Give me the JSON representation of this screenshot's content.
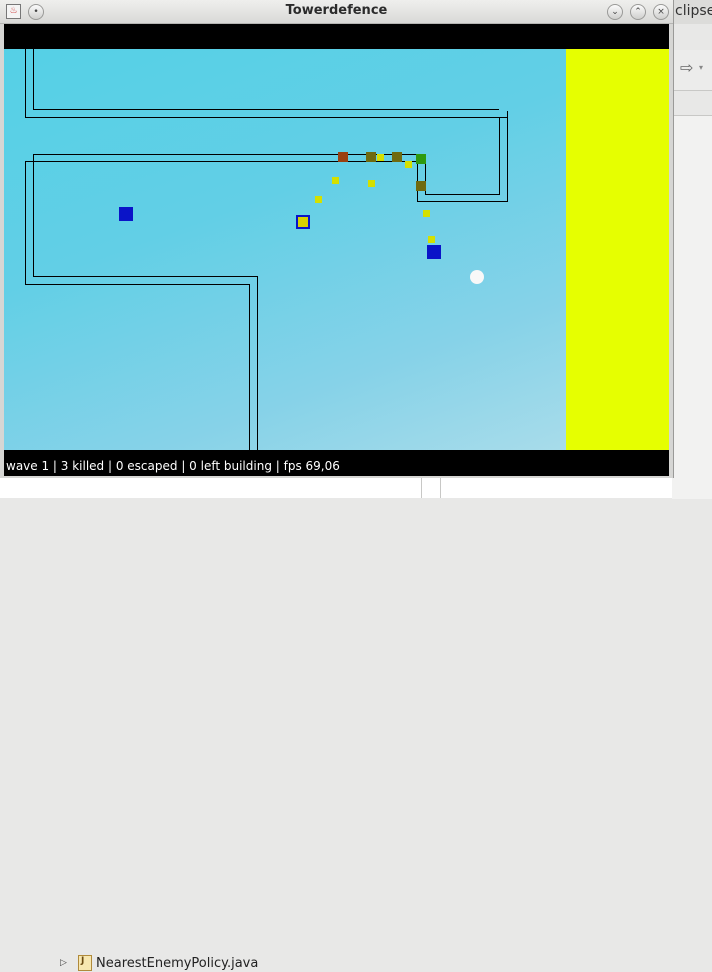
{
  "window": {
    "title": "Towerdefence",
    "status_text": "wave 1 | 3 killed | 0 escaped | 0 left building | fps 69,06"
  },
  "background_ide": {
    "title_fragment": "clipse",
    "tree_item": "NearestEnemyPolicy.java"
  },
  "colors": {
    "sidebar": "#e6ff00",
    "tower": "#0a14c8",
    "orb": "#f8f8f8",
    "path": "#000000"
  },
  "icons": [
    "app-icon",
    "minimize-icon",
    "maximize-icon",
    "close-icon",
    "pin-icon",
    "forward-arrow-icon",
    "expand-triangle-icon",
    "java-file-icon"
  ]
}
